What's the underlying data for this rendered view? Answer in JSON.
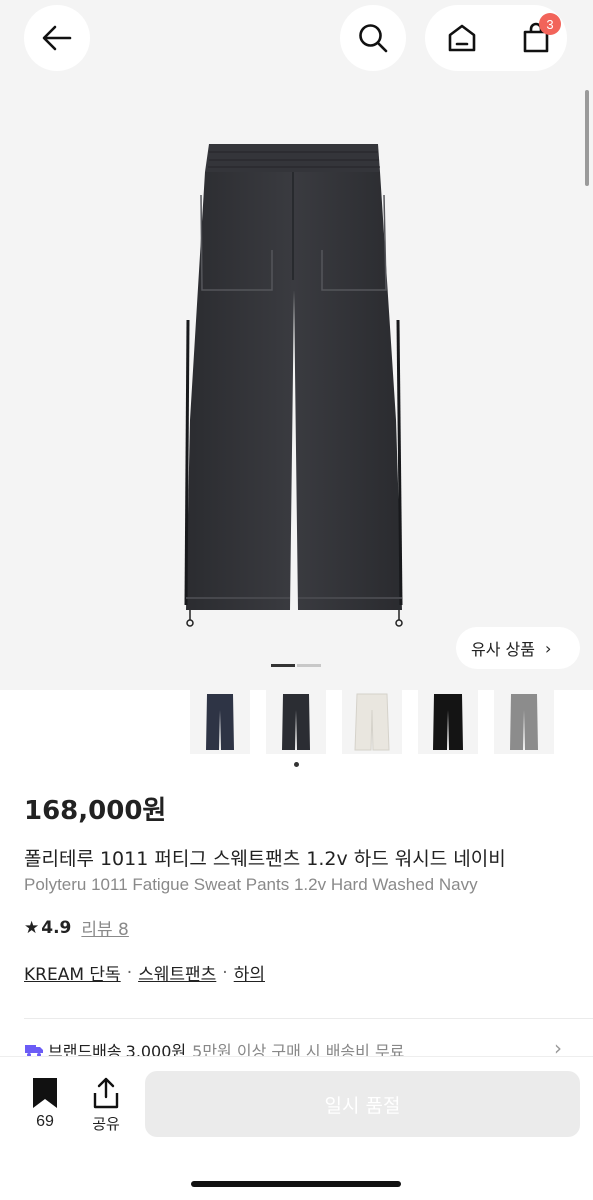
{
  "header": {
    "back_icon": "arrow-left-icon",
    "search_icon": "search-icon",
    "home_icon": "home-icon",
    "cart_icon": "shopping-bag-icon",
    "cart_badge": "3",
    "badge_color": "#f2645a"
  },
  "gallery": {
    "similar_label": "유사 상품",
    "similar_chevron": "›",
    "page_indicator": {
      "current": 1,
      "total": 2
    },
    "thumbnails": [
      {
        "name": "navy",
        "color": "#2e3445"
      },
      {
        "name": "charcoal",
        "color": "#2b2d33"
      },
      {
        "name": "ivory",
        "color": "#e9e6df"
      },
      {
        "name": "black",
        "color": "#141414"
      },
      {
        "name": "grey",
        "color": "#8c8c8c"
      }
    ],
    "selected_thumbnail": 2
  },
  "product": {
    "price": "168,000원",
    "title_ko": "폴리테루 1011 퍼티그 스웨트팬츠 1.2v 하드 워시드 네이비",
    "title_en": "Polyteru 1011 Fatigue Sweat Pants 1.2v Hard Washed Navy",
    "rating": {
      "star": "★",
      "score": "4.9",
      "review_label": "리뷰 8"
    },
    "tags": [
      "KREAM 단독",
      "스웨트팬츠",
      "하의"
    ],
    "tag_separator": "·"
  },
  "shipping": {
    "icon": "truck-icon",
    "icon_color": "#6b5cf6",
    "label": "브랜드배송",
    "fee": "3,000원",
    "note": "5만원 이상 구매 시 배송비 무료",
    "chevron": "›"
  },
  "bottom_bar": {
    "bookmark_icon": "bookmark-icon",
    "bookmark_count": "69",
    "share_icon": "share-icon",
    "share_label": "공유",
    "soldout_label": "일시 품절"
  }
}
